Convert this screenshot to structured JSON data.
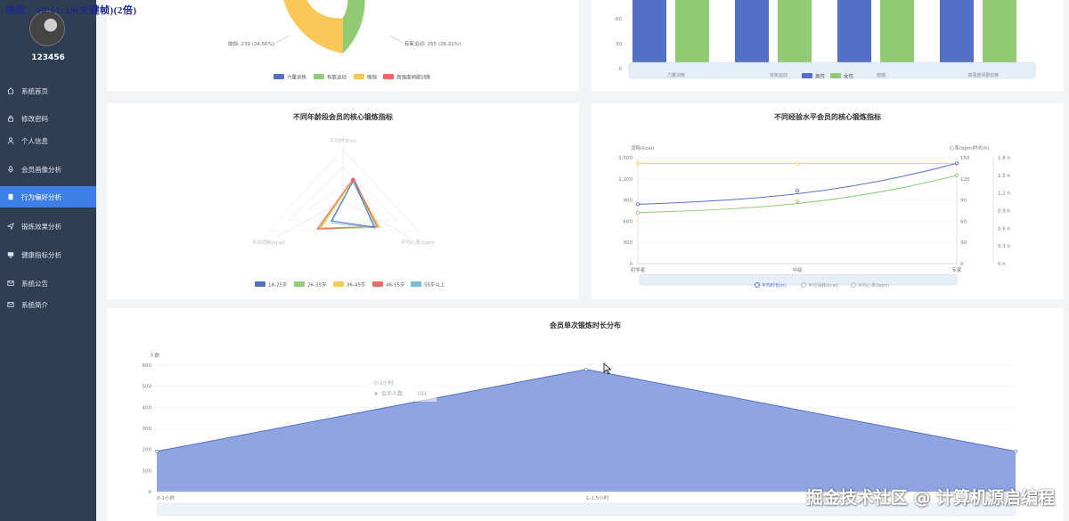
{
  "overlay": {
    "recording_text": "搜索：00:01:19(关键帧)(2倍)"
  },
  "colors": {
    "sidebar_bg": "#2f3e53",
    "active_item": "#3e7fe6",
    "blue": "#5470c6",
    "green": "#91cc75",
    "yellow": "#fac858",
    "red": "#ee6666",
    "cyan": "#73c0de"
  },
  "sidebar": {
    "username": "123456",
    "items": [
      {
        "label": "系统首页",
        "icon": "home-icon"
      },
      {
        "label": "修改密码",
        "icon": "lock-icon"
      },
      {
        "label": "个人信息",
        "icon": "user-icon"
      },
      {
        "label": "会员画像分析",
        "icon": "mic-icon"
      },
      {
        "label": "行为偏好分析",
        "icon": "document-icon",
        "active": true
      },
      {
        "label": "锻炼效果分析",
        "icon": "send-icon"
      },
      {
        "label": "健康指标分析",
        "icon": "monitor-icon"
      },
      {
        "label": "系统公告",
        "icon": "mail-icon"
      },
      {
        "label": "系统简介",
        "icon": "mail-icon"
      }
    ]
  },
  "pie_card": {
    "label_left": "瑜伽: 239 (24.56%)",
    "label_right": "有氧运动: 255 (26.21%)",
    "legend": [
      "力量训练",
      "有氧运动",
      "瑜伽",
      "高强度间歇训练"
    ]
  },
  "bar_card": {
    "y_ticks": [
      "60",
      "30",
      "0"
    ],
    "categories": [
      "力量训练",
      "有氧运动",
      "瑜伽",
      "高强度间歇训练"
    ],
    "legend": [
      "男性",
      "女性"
    ]
  },
  "radar_card": {
    "title": "不同年龄段会员的核心锻炼指标",
    "indicators": [
      "平均时长(h)",
      "平均消耗(kcal)",
      "平均心率(bpm)"
    ],
    "legend": [
      "18-25岁",
      "26-35岁",
      "36-45岁",
      "46-55岁",
      "55岁以上"
    ]
  },
  "line_card": {
    "title": "不同经验水平会员的核心锻炼指标",
    "left_axis_name": "消耗(kcal)",
    "mid_axis_name": "心率(bpm)",
    "right_axis_name": "时长(h)",
    "left_ticks": [
      "1,500",
      "1,200",
      "900",
      "600",
      "300",
      "0"
    ],
    "mid_ticks": [
      "150",
      "120",
      "90",
      "60",
      "30",
      "0"
    ],
    "right_ticks": [
      "1.8 h",
      "1.5 h",
      "1.2 h",
      "0.9 h",
      "0.6 h",
      "0.3 h",
      "0 h"
    ],
    "categories": [
      "初学者",
      "中级",
      "专家"
    ],
    "legend": [
      "平均时长(h)",
      "平均消耗(kcal)",
      "平均心率(bpm)"
    ]
  },
  "area_card": {
    "title": "会员单次锻炼时长分布",
    "y_axis_name": "人数",
    "y_ticks": [
      "600",
      "500",
      "400",
      "300",
      "200",
      "100",
      "0"
    ],
    "x_labels": [
      "0-1小时",
      "1-1.5小时"
    ],
    "tooltip_title": "0-1小时",
    "tooltip_series": "会员人数",
    "tooltip_value": "191"
  },
  "chart_data": [
    {
      "type": "pie",
      "categories": [
        "力量训练",
        "有氧运动",
        "瑜伽",
        "高强度间歇训练"
      ],
      "values": [
        null,
        255,
        239,
        null
      ],
      "legend": [
        "力量训练",
        "有氧运动",
        "瑜伽",
        "高强度间歇训练"
      ]
    },
    {
      "type": "bar",
      "categories": [
        "力量训练",
        "有氧运动",
        "瑜伽",
        "高强度间歇训练"
      ],
      "series": [
        {
          "name": "男性",
          "values": [
            120,
            120,
            120,
            120
          ]
        },
        {
          "name": "女性",
          "values": [
            120,
            120,
            120,
            120
          ]
        }
      ],
      "ylim": [
        0,
        60
      ]
    },
    {
      "type": "line",
      "title": "不同经验水平会员的核心锻炼指标",
      "categories": [
        "初学者",
        "中级",
        "专家"
      ],
      "series": [
        {
          "name": "平均时长(h)",
          "values": [
            1.7,
            1.7,
            1.7
          ]
        },
        {
          "name": "平均消耗(kcal)",
          "values": [
            840,
            1030,
            1420
          ]
        },
        {
          "name": "平均心率(bpm)",
          "values": [
            72,
            88,
            125
          ]
        }
      ]
    },
    {
      "type": "area",
      "title": "会员单次锻炼时长分布",
      "categories": [
        "0-1小时",
        "1-1.5小时",
        ""
      ],
      "values": [
        191,
        580,
        191
      ],
      "ylabel": "人数",
      "ylim": [
        0,
        600
      ]
    }
  ]
}
